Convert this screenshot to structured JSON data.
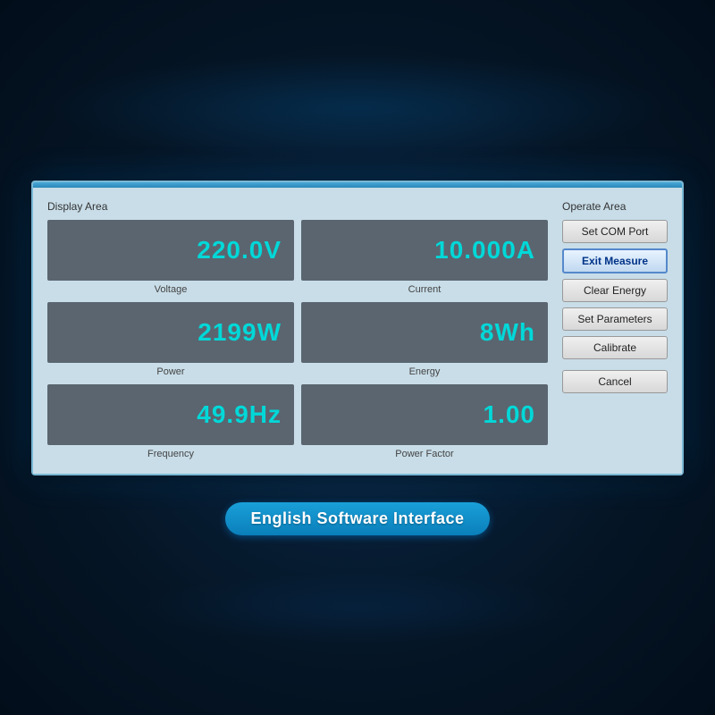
{
  "background": {
    "color_start": "#0a2a4a",
    "color_end": "#020d1a"
  },
  "window": {
    "display_area_label": "Display Area",
    "operate_area_label": "Operate Area",
    "meters": [
      {
        "id": "voltage",
        "value": "220.0V",
        "label": "Voltage"
      },
      {
        "id": "current",
        "value": "10.000A",
        "label": "Current"
      },
      {
        "id": "power",
        "value": "2199W",
        "label": "Power"
      },
      {
        "id": "energy",
        "value": "8Wh",
        "label": "Energy"
      },
      {
        "id": "frequency",
        "value": "49.9Hz",
        "label": "Frequency"
      },
      {
        "id": "power-factor",
        "value": "1.00",
        "label": "Power Factor"
      }
    ],
    "buttons": [
      {
        "id": "set-com-port",
        "label": "Set COM Port",
        "active": false
      },
      {
        "id": "exit-measure",
        "label": "Exit Measure",
        "active": true
      },
      {
        "id": "clear-energy",
        "label": "Clear Energy",
        "active": false
      },
      {
        "id": "set-parameters",
        "label": "Set Parameters",
        "active": false
      },
      {
        "id": "calibrate",
        "label": "Calibrate",
        "active": false
      },
      {
        "id": "cancel",
        "label": "Cancel",
        "active": false
      }
    ]
  },
  "footer": {
    "label": "English Software Interface"
  }
}
